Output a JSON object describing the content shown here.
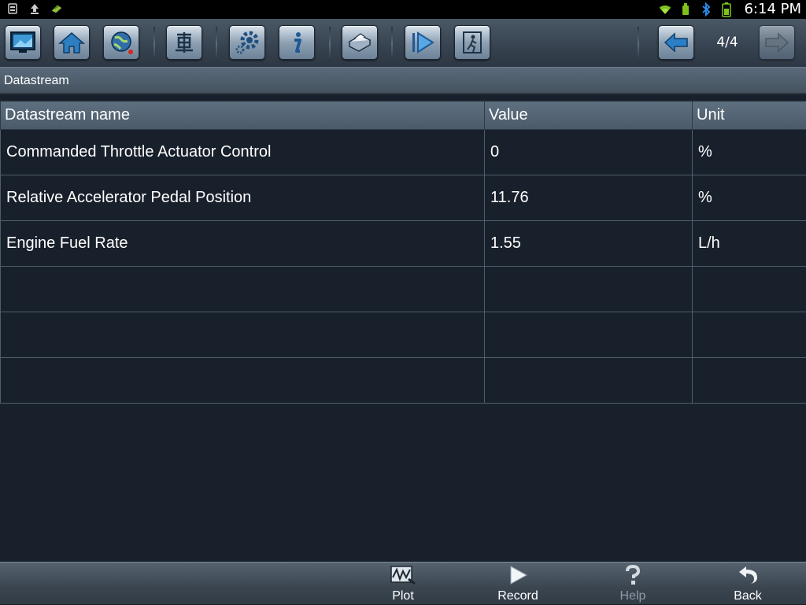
{
  "status_bar": {
    "left_icons": [
      "notification-icon",
      "upload-icon",
      "download-icon"
    ],
    "right_icons": [
      "wifi-icon",
      "usb-icon",
      "bluetooth-icon",
      "battery-icon"
    ],
    "clock": "6:14 PM"
  },
  "toolbar": {
    "buttons": [
      "display-icon",
      "home-icon",
      "globe-icon",
      "vehicle-icon",
      "settings-icon",
      "info-icon",
      "print-icon",
      "play-icon",
      "exit-icon"
    ],
    "page_indicator": "4/4",
    "prev_icon": "arrow-left-icon",
    "next_icon": "arrow-right-icon"
  },
  "section": {
    "title": "Datastream"
  },
  "table": {
    "headers": [
      "Datastream name",
      "Value",
      "Unit"
    ],
    "rows": [
      [
        "Commanded Throttle Actuator Control",
        "0",
        "%"
      ],
      [
        "Relative Accelerator Pedal Position",
        "11.76",
        "%"
      ],
      [
        "Engine Fuel Rate",
        "1.55",
        "L/h"
      ],
      [
        "",
        "",
        ""
      ],
      [
        "",
        "",
        ""
      ],
      [
        "",
        "",
        ""
      ]
    ]
  },
  "bottom_bar": {
    "plot_label": "Plot",
    "record_label": "Record",
    "help_label": "Help",
    "back_label": "Back"
  },
  "colors": {
    "background": "#18202b",
    "toolbar": "#36424f",
    "header": "#4a5a69",
    "disabled_text": "#8d99a5"
  }
}
